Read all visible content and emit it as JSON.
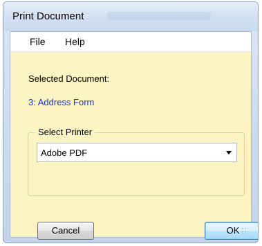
{
  "window": {
    "title": "Print Document"
  },
  "menu": {
    "items": [
      {
        "label": "File"
      },
      {
        "label": "Help"
      }
    ]
  },
  "document": {
    "label": "Selected Document:",
    "value": "3: Address Form"
  },
  "printer_group": {
    "legend": "Select Printer",
    "selected_printer": "Adobe PDF"
  },
  "buttons": {
    "cancel_label": "Cancel",
    "ok_label": "OK"
  },
  "colors": {
    "client_background": "#fcf4c2",
    "document_link": "#1a33c7",
    "title_bar": "#d3e0f1"
  },
  "icons": {
    "dropdown": "chevron-down-icon",
    "resize": "resize-grip-icon"
  }
}
